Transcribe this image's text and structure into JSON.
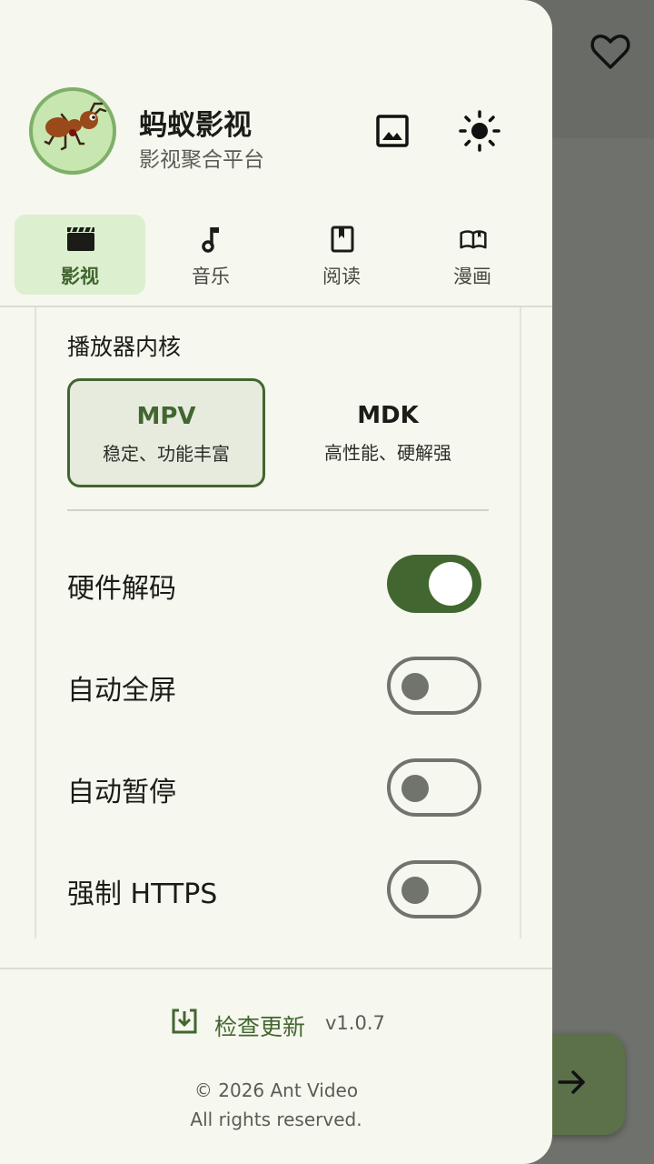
{
  "app": {
    "name": "蚂蚁影视",
    "subtitle": "影视聚合平台"
  },
  "header": {
    "wallpaper_icon": "image-icon",
    "theme_icon": "sun-icon"
  },
  "tabs": [
    {
      "label": "影视",
      "icon": "clapperboard-icon",
      "active": true
    },
    {
      "label": "音乐",
      "icon": "music-note-icon",
      "active": false
    },
    {
      "label": "阅读",
      "icon": "book-icon",
      "active": false
    },
    {
      "label": "漫画",
      "icon": "open-book-icon",
      "active": false
    }
  ],
  "player": {
    "section_title": "播放器内核",
    "options": [
      {
        "name": "MPV",
        "desc": "稳定、功能丰富",
        "selected": true
      },
      {
        "name": "MDK",
        "desc": "高性能、硬解强",
        "selected": false
      }
    ]
  },
  "settings": [
    {
      "label": "硬件解码",
      "on": true
    },
    {
      "label": "自动全屏",
      "on": false
    },
    {
      "label": "自动暂停",
      "on": false
    },
    {
      "label": "强制 HTTPS",
      "on": false
    }
  ],
  "footer": {
    "update_label": "检查更新",
    "version": "v1.0.7",
    "copyright": "© 2026 Ant Video",
    "rights": "All rights reserved."
  },
  "background": {
    "favorite_icon": "heart-icon",
    "fab_icon": "arrow-right-icon"
  },
  "colors": {
    "accent": "#426630",
    "drawer_bg": "#f6f7ee",
    "active_tab_bg": "#dcefcf"
  }
}
